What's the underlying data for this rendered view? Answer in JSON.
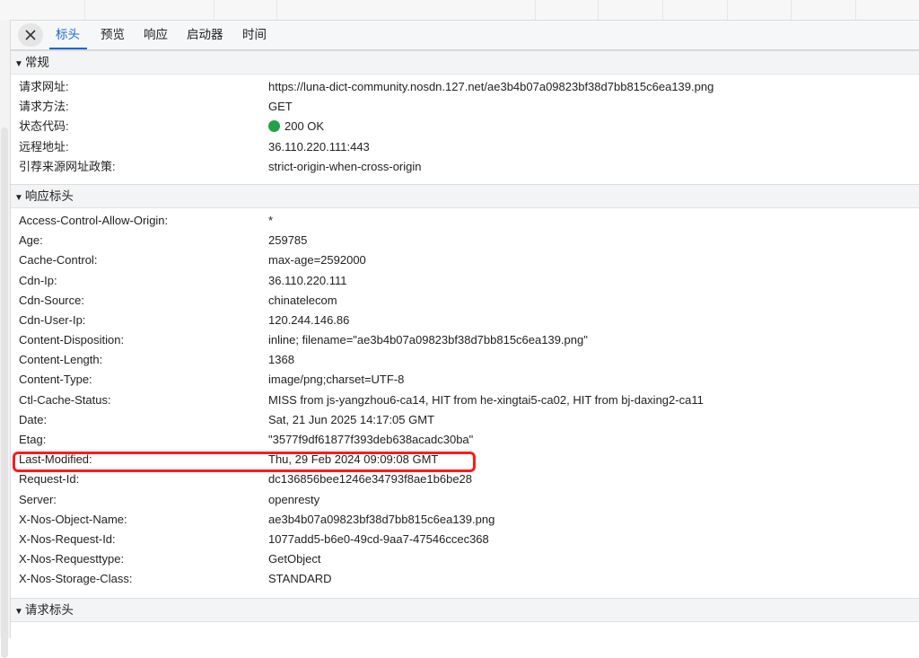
{
  "tabs": [
    "标头",
    "预览",
    "响应",
    "启动器",
    "时间"
  ],
  "sections": {
    "general": {
      "title": "常规",
      "rows": [
        {
          "key": "请求网址:",
          "value": "https://luna-dict-community.nosdn.127.net/ae3b4b07a09823bf38d7bb815c6ea139.png"
        },
        {
          "key": "请求方法:",
          "value": "GET"
        },
        {
          "key": "状态代码:",
          "value": "200 OK"
        },
        {
          "key": "远程地址:",
          "value": "36.110.220.111:443"
        },
        {
          "key": "引荐来源网址政策:",
          "value": "strict-origin-when-cross-origin"
        }
      ]
    },
    "response": {
      "title": "响应标头",
      "rows": [
        {
          "key": "Access-Control-Allow-Origin:",
          "value": "*"
        },
        {
          "key": "Age:",
          "value": "259785"
        },
        {
          "key": "Cache-Control:",
          "value": "max-age=2592000"
        },
        {
          "key": "Cdn-Ip:",
          "value": "36.110.220.111"
        },
        {
          "key": "Cdn-Source:",
          "value": "chinatelecom"
        },
        {
          "key": "Cdn-User-Ip:",
          "value": "120.244.146.86"
        },
        {
          "key": "Content-Disposition:",
          "value": "inline; filename=\"ae3b4b07a09823bf38d7bb815c6ea139.png\""
        },
        {
          "key": "Content-Length:",
          "value": "1368"
        },
        {
          "key": "Content-Type:",
          "value": "image/png;charset=UTF-8"
        },
        {
          "key": "Ctl-Cache-Status:",
          "value": "MISS from js-yangzhou6-ca14, HIT from he-xingtai5-ca02, HIT from bj-daxing2-ca11"
        },
        {
          "key": "Date:",
          "value": "Sat, 21 Jun 2025 14:17:05 GMT"
        },
        {
          "key": "Etag:",
          "value": "\"3577f9df61877f393deb638acadc30ba\""
        },
        {
          "key": "Last-Modified:",
          "value": "Thu, 29 Feb 2024 09:09:08 GMT"
        },
        {
          "key": "Request-Id:",
          "value": "dc136856bee1246e34793f8ae1b6be28"
        },
        {
          "key": "Server:",
          "value": "openresty"
        },
        {
          "key": "X-Nos-Object-Name:",
          "value": "ae3b4b07a09823bf38d7bb815c6ea139.png"
        },
        {
          "key": "X-Nos-Request-Id:",
          "value": "1077add5-b6e0-49cd-9aa7-47546ccec368"
        },
        {
          "key": "X-Nos-Requesttype:",
          "value": "GetObject"
        },
        {
          "key": "X-Nos-Storage-Class:",
          "value": "STANDARD"
        }
      ]
    },
    "request": {
      "title": "请求标头"
    }
  },
  "status_color": "#21a249",
  "highlight_color": "#ff1a1a",
  "accent_color": "#1a66d6",
  "icons": {
    "close": "close-icon",
    "collapse": "triangle-down-icon"
  }
}
